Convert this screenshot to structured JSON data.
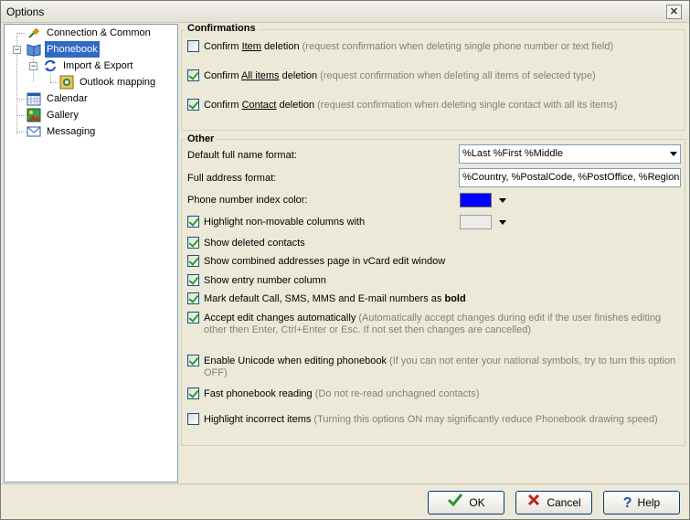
{
  "window": {
    "title": "Options",
    "close_label": "✕"
  },
  "tree": {
    "items": [
      {
        "label": "Connection & Common",
        "icon": "plug-icon"
      },
      {
        "label": "Phonebook",
        "icon": "phonebook-icon",
        "selected": true
      },
      {
        "label": "Import & Export",
        "icon": "sync-arrows-icon"
      },
      {
        "label": "Outlook mapping",
        "icon": "outlook-icon"
      },
      {
        "label": "Calendar",
        "icon": "calendar-icon"
      },
      {
        "label": "Gallery",
        "icon": "gallery-icon"
      },
      {
        "label": "Messaging",
        "icon": "envelope-icon"
      }
    ],
    "expander_minus": "−"
  },
  "confirmations": {
    "title": "Confirmations",
    "item": {
      "prefix": "Confirm ",
      "underline": "Item",
      "suffix": " deletion",
      "note": " (request confirmation when deleting single phone number or text field)",
      "checked": false
    },
    "all_items": {
      "prefix": "Confirm ",
      "underline": "All items",
      "suffix": " deletion",
      "note": " (request confirmation when deleting all items of selected type)",
      "checked": true
    },
    "contact": {
      "prefix": "Confirm ",
      "underline": "Contact",
      "suffix": " deletion",
      "note": " (request confirmation when deleting single contact with all its items)",
      "checked": true
    }
  },
  "other": {
    "title": "Other",
    "full_name_label": "Default full name format:",
    "full_name_value": "%Last %First %Middle",
    "full_address_label": "Full address format:",
    "full_address_value": "%Country, %PostalCode, %PostOffice, %Region, %I",
    "phone_color_label": "Phone number index color:",
    "phone_color": "#0000ff",
    "highlight_nonmovable": {
      "label": "Highlight non-movable columns with",
      "checked": true
    },
    "highlight_color": "#ececec",
    "show_deleted": {
      "label": "Show deleted contacts",
      "checked": true
    },
    "show_combined": {
      "label": "Show combined addresses page in vCard edit window",
      "checked": true
    },
    "show_entry_number": {
      "label": "Show entry number column",
      "checked": true
    },
    "mark_default": {
      "label": "Mark default Call, SMS, MMS and E-mail numbers as ",
      "bold": "bold",
      "checked": true
    },
    "accept_edit": {
      "label": "Accept edit changes automatically",
      "note": " (Automatically accept changes during edit if the user finishes editing other then Enter, Ctrl+Enter or Esc. If not set then changes are cancelled)",
      "checked": true
    },
    "enable_unicode": {
      "label": "Enable Unicode when editing phonebook",
      "note": " (If you can not enter your national symbols, try to turn this option OFF)",
      "checked": true
    },
    "fast_reading": {
      "label": "Fast phonebook reading",
      "note": " (Do not re-read unchagned contacts)",
      "checked": true
    },
    "highlight_incorrect": {
      "label": "Highlight incorrect items",
      "note": " (Turning this options ON may significantly reduce Phonebook drawing speed)",
      "checked": false
    }
  },
  "buttons": {
    "ok": "OK",
    "cancel": "Cancel",
    "help": "Help"
  },
  "colors": {
    "ok_check": "#2a9a2a",
    "cancel_x": "#c0201a",
    "help_q": "#1b4fa8",
    "selection": "#316ac5"
  }
}
